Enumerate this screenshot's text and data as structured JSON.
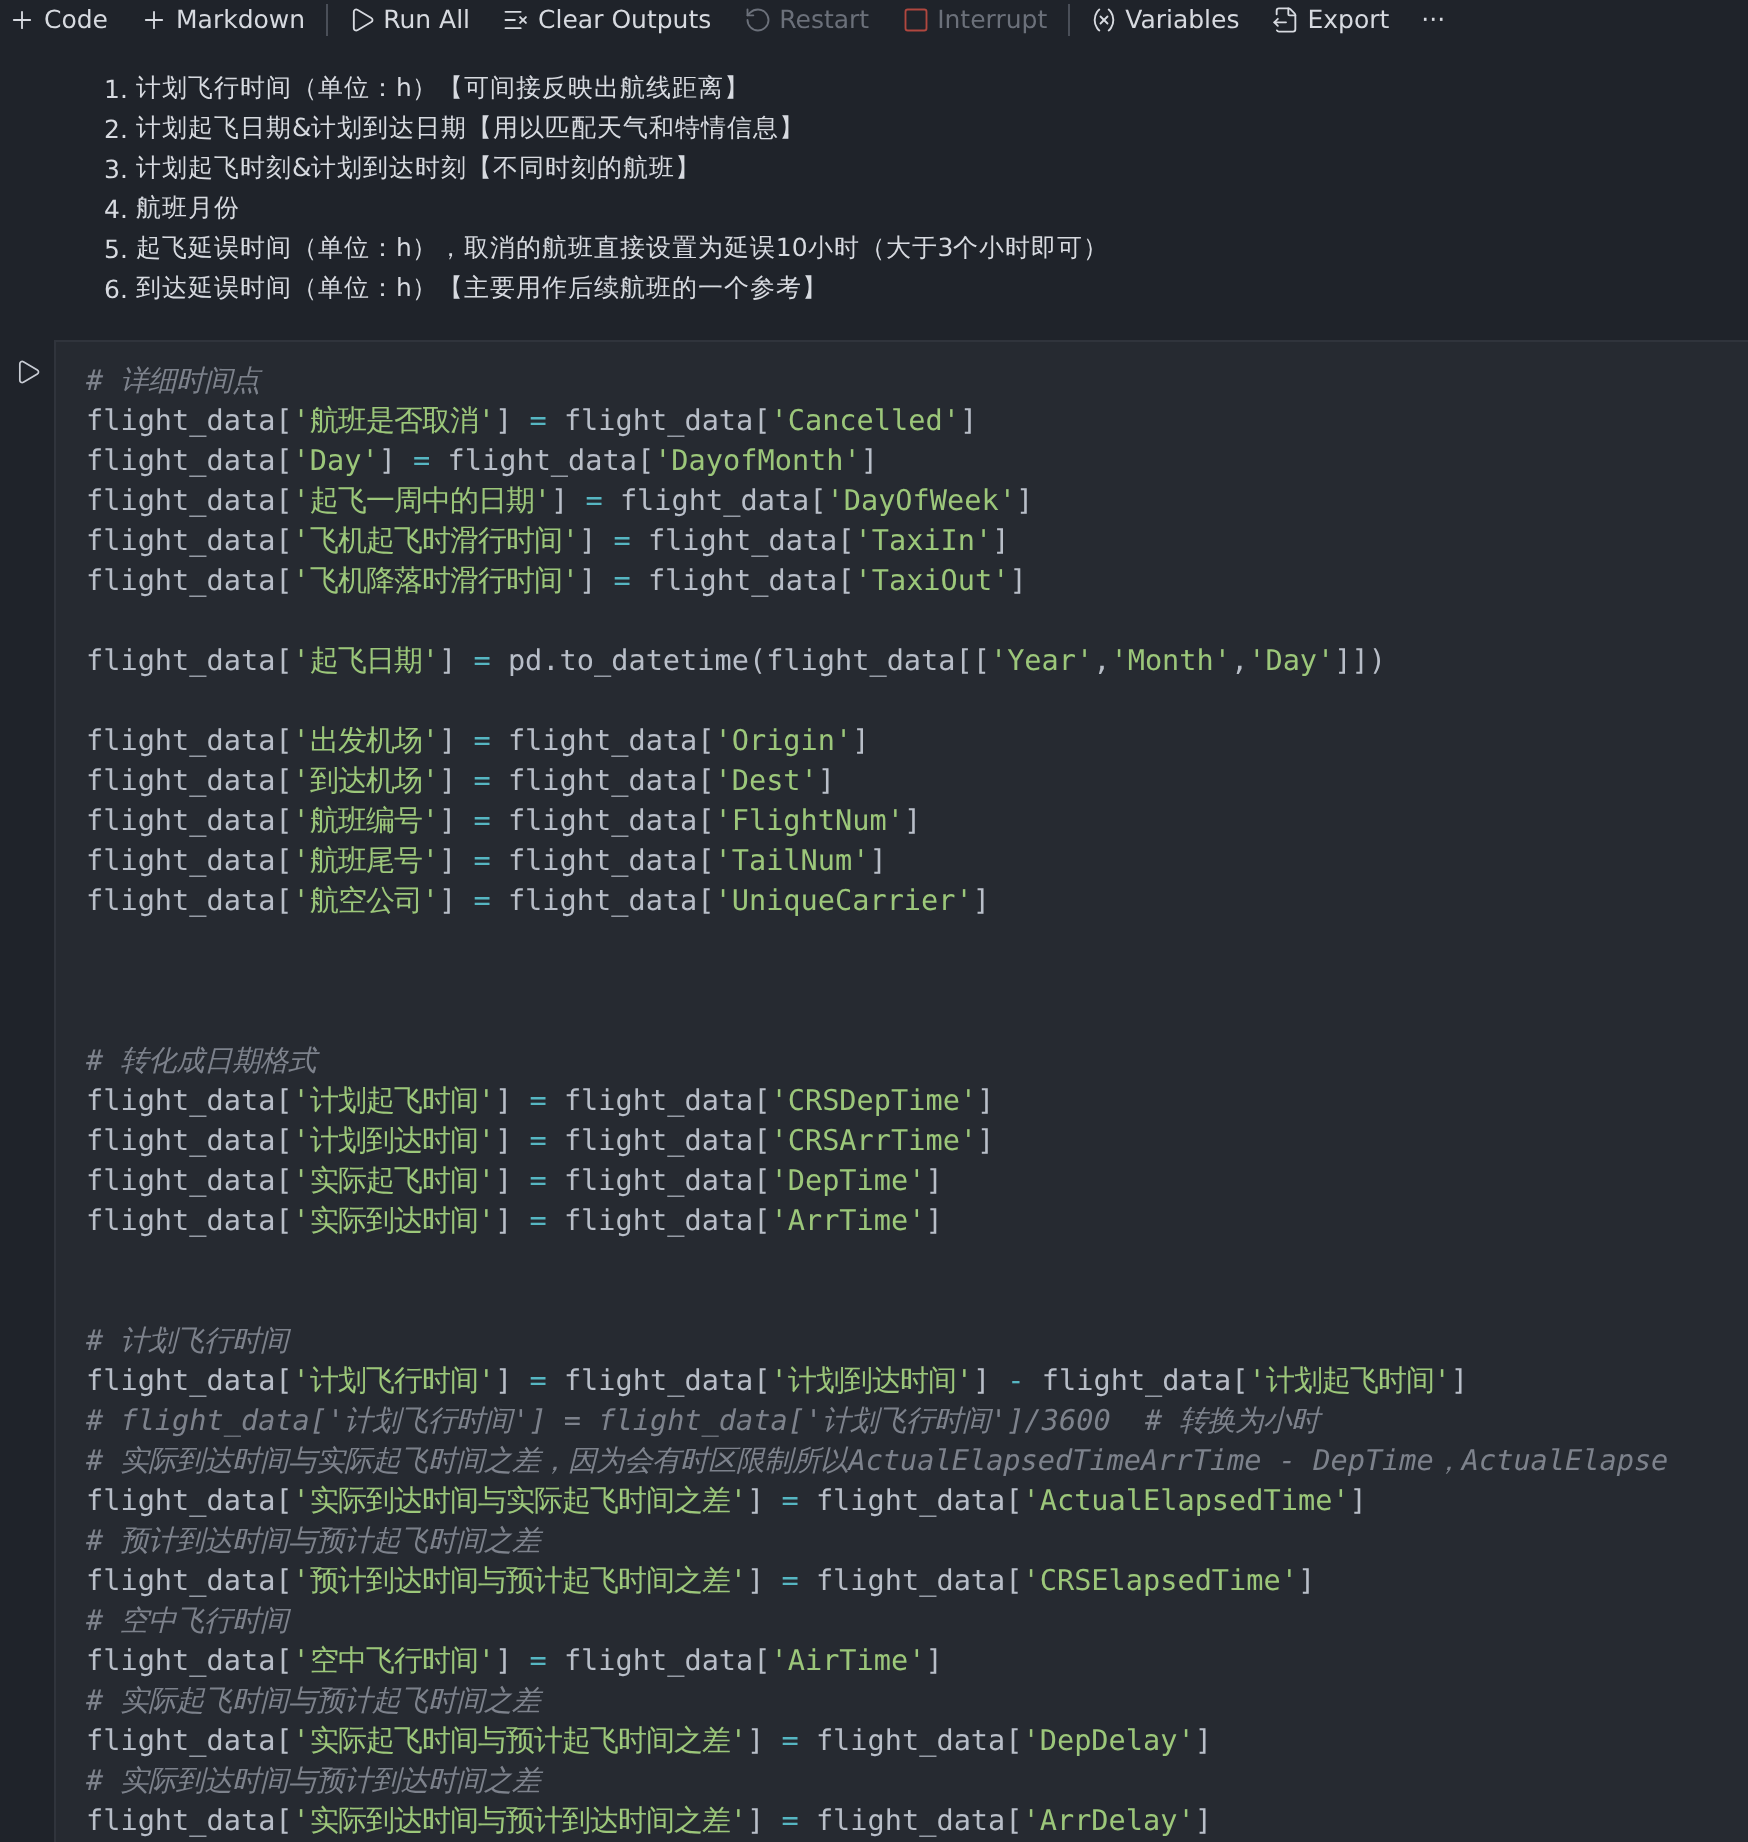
{
  "toolbar": {
    "items": [
      {
        "kind": "plus",
        "label": "Code",
        "disabled": false
      },
      {
        "kind": "plus",
        "label": "Markdown",
        "disabled": false
      },
      {
        "kind": "separator"
      },
      {
        "kind": "play",
        "label": "Run All",
        "disabled": false
      },
      {
        "kind": "clear",
        "label": "Clear Outputs",
        "disabled": false
      },
      {
        "kind": "restart",
        "label": "Restart",
        "disabled": true
      },
      {
        "kind": "interrupt",
        "label": "Interrupt",
        "disabled": true
      },
      {
        "kind": "separator"
      },
      {
        "kind": "variables",
        "label": "Variables",
        "disabled": false
      },
      {
        "kind": "export",
        "label": "Export",
        "disabled": false
      },
      {
        "kind": "more",
        "label": "···",
        "disabled": false
      }
    ]
  },
  "markdown_list": [
    {
      "number": "1.",
      "text": "计划飞行时间（单位：h）【可间接反映出航线距离】"
    },
    {
      "number": "2.",
      "text": "计划起飞日期&计划到达日期【用以匹配天气和特情信息】"
    },
    {
      "number": "3.",
      "text": "计划起飞时刻&计划到达时刻【不同时刻的航班】"
    },
    {
      "number": "4.",
      "text": "航班月份"
    },
    {
      "number": "5.",
      "text": "起飞延误时间（单位：h），取消的航班直接设置为延误10小时（大于3个小时即可）"
    },
    {
      "number": "6.",
      "text": "到达延误时间（单位：h）【主要用作后续航班的一个参考】"
    }
  ],
  "code_cell": {
    "lines": [
      {
        "kind": "comment",
        "text": "# 详细时间点"
      },
      {
        "kind": "code",
        "text": "flight_data['航班是否取消'] = flight_data['Cancelled']"
      },
      {
        "kind": "code",
        "text": "flight_data['Day'] = flight_data['DayofMonth']"
      },
      {
        "kind": "code",
        "text": "flight_data['起飞一周中的日期'] = flight_data['DayOfWeek']"
      },
      {
        "kind": "code",
        "text": "flight_data['飞机起飞时滑行时间'] = flight_data['TaxiIn']"
      },
      {
        "kind": "code",
        "text": "flight_data['飞机降落时滑行时间'] = flight_data['TaxiOut']"
      },
      {
        "kind": "blank"
      },
      {
        "kind": "code",
        "text": "flight_data['起飞日期'] = pd.to_datetime(flight_data[['Year','Month','Day']])"
      },
      {
        "kind": "blank"
      },
      {
        "kind": "code",
        "text": "flight_data['出发机场'] = flight_data['Origin']"
      },
      {
        "kind": "code",
        "text": "flight_data['到达机场'] = flight_data['Dest']"
      },
      {
        "kind": "code",
        "text": "flight_data['航班编号'] = flight_data['FlightNum']"
      },
      {
        "kind": "code",
        "text": "flight_data['航班尾号'] = flight_data['TailNum']"
      },
      {
        "kind": "code",
        "text": "flight_data['航空公司'] = flight_data['UniqueCarrier']"
      },
      {
        "kind": "blank"
      },
      {
        "kind": "blank"
      },
      {
        "kind": "blank"
      },
      {
        "kind": "comment",
        "text": "# 转化成日期格式"
      },
      {
        "kind": "code",
        "text": "flight_data['计划起飞时间'] = flight_data['CRSDepTime']"
      },
      {
        "kind": "code",
        "text": "flight_data['计划到达时间'] = flight_data['CRSArrTime']"
      },
      {
        "kind": "code",
        "text": "flight_data['实际起飞时间'] = flight_data['DepTime']"
      },
      {
        "kind": "code",
        "text": "flight_data['实际到达时间'] = flight_data['ArrTime']"
      },
      {
        "kind": "blank"
      },
      {
        "kind": "blank"
      },
      {
        "kind": "comment",
        "text": "# 计划飞行时间"
      },
      {
        "kind": "code",
        "text": "flight_data['计划飞行时间'] = flight_data['计划到达时间'] - flight_data['计划起飞时间']"
      },
      {
        "kind": "comment",
        "text": "# flight_data['计划飞行时间'] = flight_data['计划飞行时间']/3600  # 转换为小时"
      },
      {
        "kind": "comment",
        "text": "# 实际到达时间与实际起飞时间之差，因为会有时区限制所以ActualElapsedTimeArrTime - DepTime，ActualElapse"
      },
      {
        "kind": "code",
        "text": "flight_data['实际到达时间与实际起飞时间之差'] = flight_data['ActualElapsedTime']"
      },
      {
        "kind": "comment",
        "text": "# 预计到达时间与预计起飞时间之差"
      },
      {
        "kind": "code",
        "text": "flight_data['预计到达时间与预计起飞时间之差'] = flight_data['CRSElapsedTime']"
      },
      {
        "kind": "comment",
        "text": "# 空中飞行时间"
      },
      {
        "kind": "code",
        "text": "flight_data['空中飞行时间'] = flight_data['AirTime']"
      },
      {
        "kind": "comment",
        "text": "# 实际起飞时间与预计起飞时间之差"
      },
      {
        "kind": "code",
        "text": "flight_data['实际起飞时间与预计起飞时间之差'] = flight_data['DepDelay']"
      },
      {
        "kind": "comment",
        "text": "# 实际到达时间与预计到达时间之差"
      },
      {
        "kind": "code",
        "text": "flight_data['实际到达时间与预计到达时间之差'] = flight_data['ArrDelay']"
      }
    ]
  }
}
